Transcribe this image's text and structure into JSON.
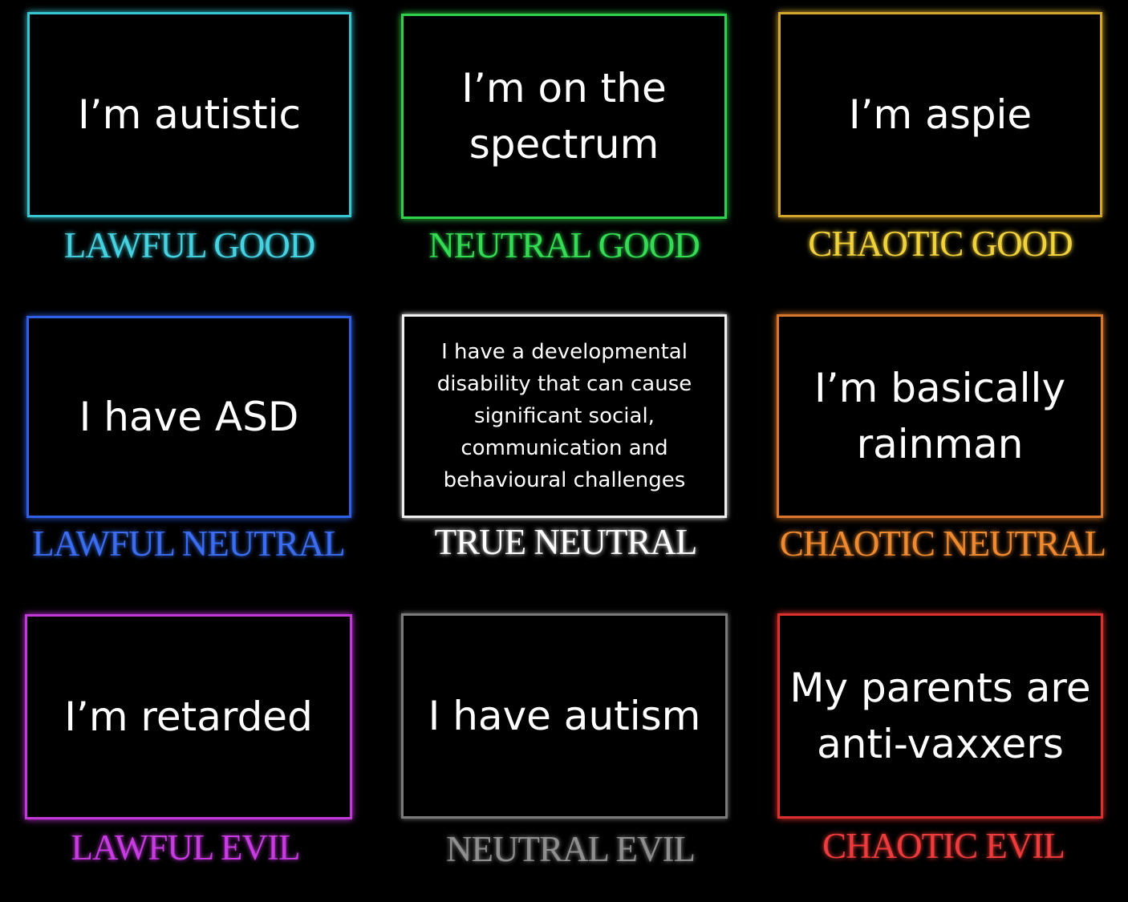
{
  "cells": [
    {
      "text": "I’m autistic",
      "label": "LAWFUL GOOD",
      "color": "#37c6d2"
    },
    {
      "text": "I’m on the spectrum",
      "label": "NEUTRAL GOOD",
      "color": "#2fd14a"
    },
    {
      "text": "I’m aspie",
      "label": "CHAOTIC GOOD",
      "color": "#d1a62e"
    },
    {
      "text": "I have ASD",
      "label": "LAWFUL NEUTRAL",
      "color": "#2e5fe6"
    },
    {
      "text": "I have a developmental disability that can cause significant social, communication and behavioural challenges",
      "label": "TRUE NEUTRAL",
      "color": "#f0f0f0"
    },
    {
      "text": "I’m basically rainman",
      "label": "CHAOTIC NEUTRAL",
      "color": "#d9782a"
    },
    {
      "text": "I’m retarded",
      "label": "LAWFUL EVIL",
      "color": "#c238d8"
    },
    {
      "text": "I have autism",
      "label": "NEUTRAL EVIL",
      "color": "#7a7a7a"
    },
    {
      "text": "My parents are anti-vaxxers",
      "label": "CHAOTIC EVIL",
      "color": "#de2f2f"
    }
  ]
}
